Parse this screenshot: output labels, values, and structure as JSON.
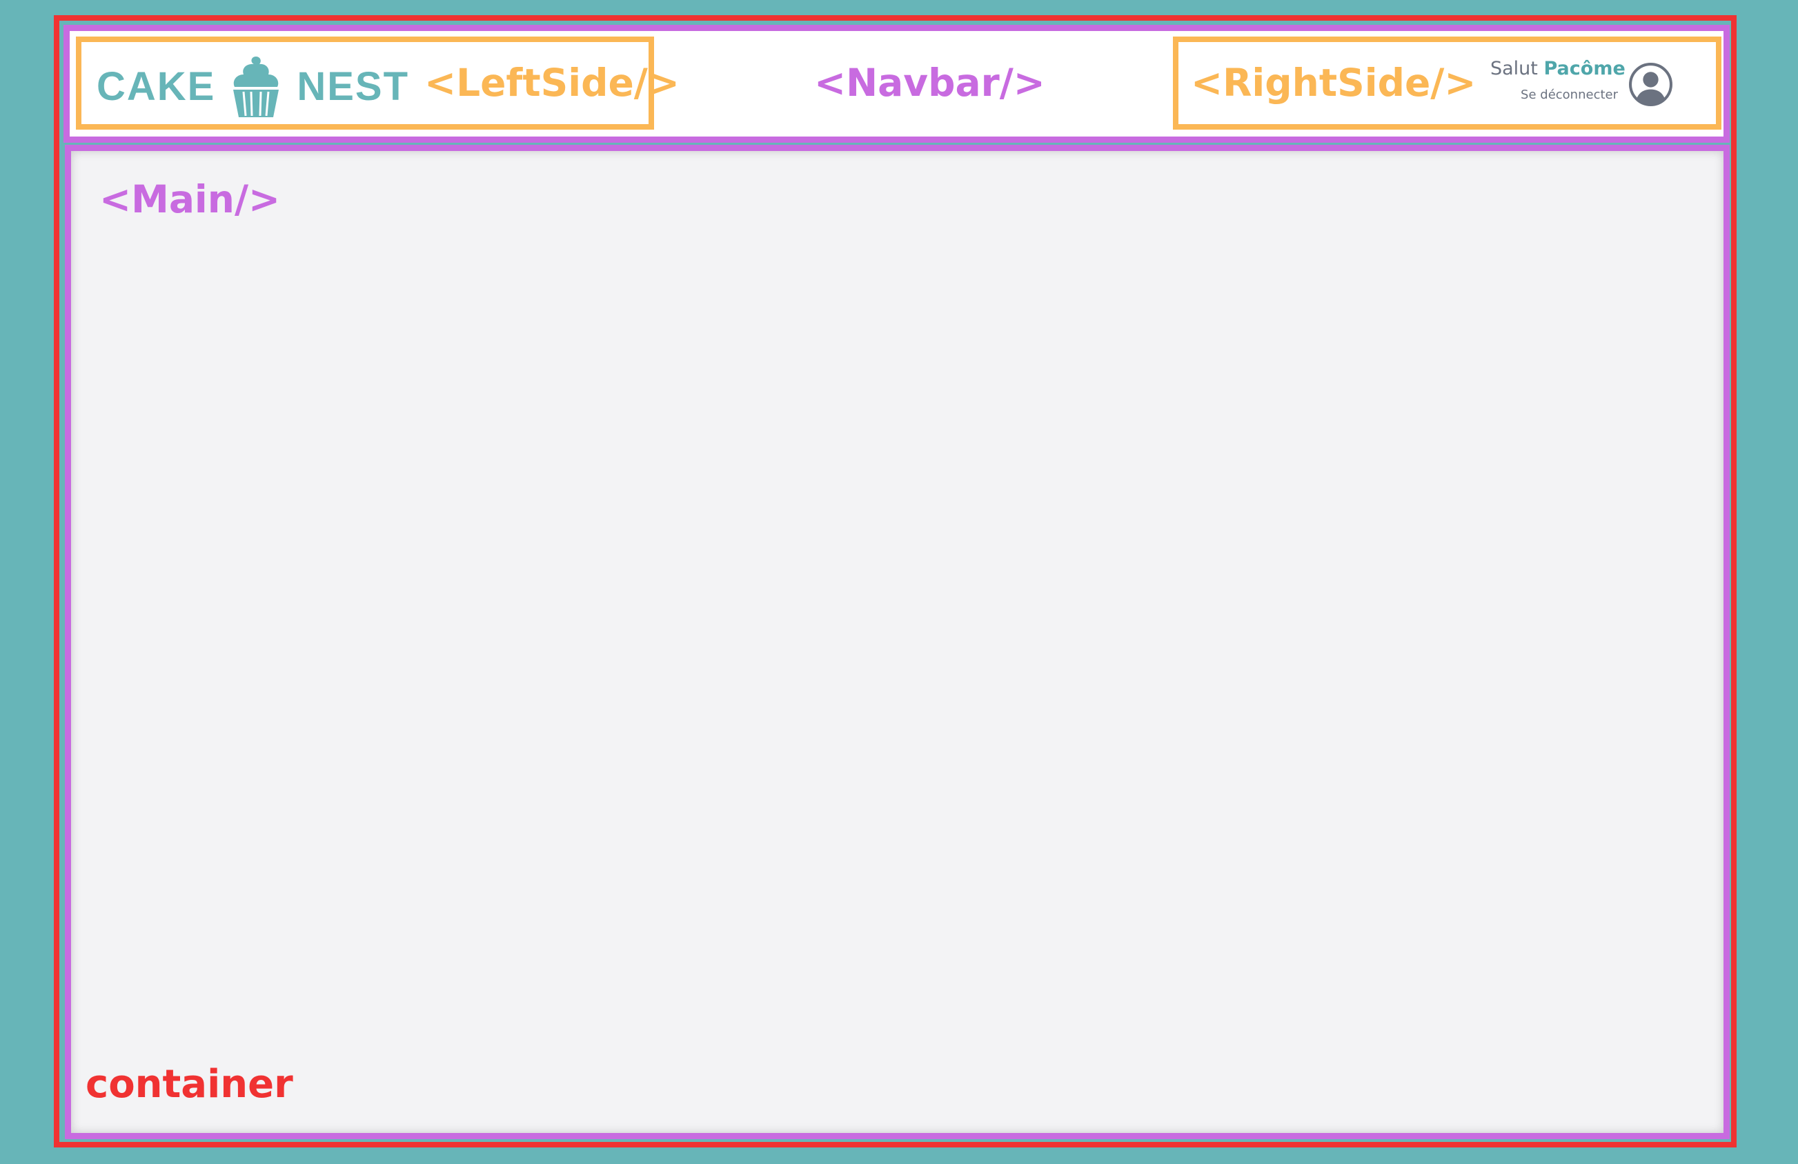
{
  "labels": {
    "container": "container",
    "navbar": "<Navbar/>",
    "left_side": "<LeftSide/>",
    "right_side": "<RightSide/>",
    "main": "<Main/>"
  },
  "logo": {
    "word1": "CAKE",
    "word2": "NEST",
    "icon": "cupcake-icon"
  },
  "user": {
    "greeting": "Salut",
    "name": "Pacôme",
    "logout": "Se déconnecter",
    "avatar_icon": "user-circle-icon"
  },
  "colors": {
    "background": "#67b5b8",
    "container_border": "#f03232",
    "component_border": "#c86be0",
    "side_border": "#fbb755",
    "brand": "#67b5b8",
    "main_background": "#f3f3f5"
  }
}
